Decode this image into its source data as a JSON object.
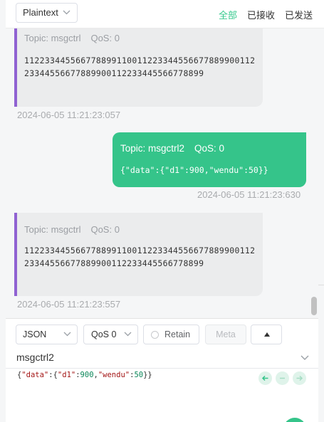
{
  "topbar": {
    "format": "Plaintext",
    "filters": [
      "全部",
      "已接收",
      "已发送"
    ],
    "active_filter": "全部"
  },
  "messages": [
    {
      "direction": "received",
      "topic": "Topic: msgctrl",
      "qos": "QoS: 0",
      "payload": "11223344556677889911001122334455667788990011223344556677889900112233445566778899",
      "time": "2024-06-05 11:21:23:057"
    },
    {
      "direction": "sent",
      "topic": "Topic: msgctrl2",
      "qos": "QoS: 0",
      "payload": "{\"data\":{\"d1\":900,\"wendu\":50}}",
      "time": "2024-06-05 11:21:23:630"
    },
    {
      "direction": "received",
      "topic": "Topic: msgctrl",
      "qos": "QoS: 0",
      "payload": "11223344556677889911001122334455667788990011223344556677889900112233445566778899",
      "time": "2024-06-05 11:21:23:557"
    }
  ],
  "composer": {
    "payload_format": "JSON",
    "qos": "QoS 0",
    "retain_label": "Retain",
    "meta_label": "Meta",
    "topic": "msgctrl2",
    "payload_tokens": {
      "open1": "{",
      "key_data": "\"data\"",
      "colon1": ":",
      "open2": "{",
      "key_d1": "\"d1\"",
      "colon2": ":",
      "val_d1": "900",
      "comma": ",",
      "key_wendu": "\"wendu\"",
      "colon3": ":",
      "val_wendu": "50",
      "close": "}}"
    }
  },
  "colors": {
    "accent": "#35c48a",
    "received_border": "#9062d2",
    "received_bg": "#ebeced"
  }
}
